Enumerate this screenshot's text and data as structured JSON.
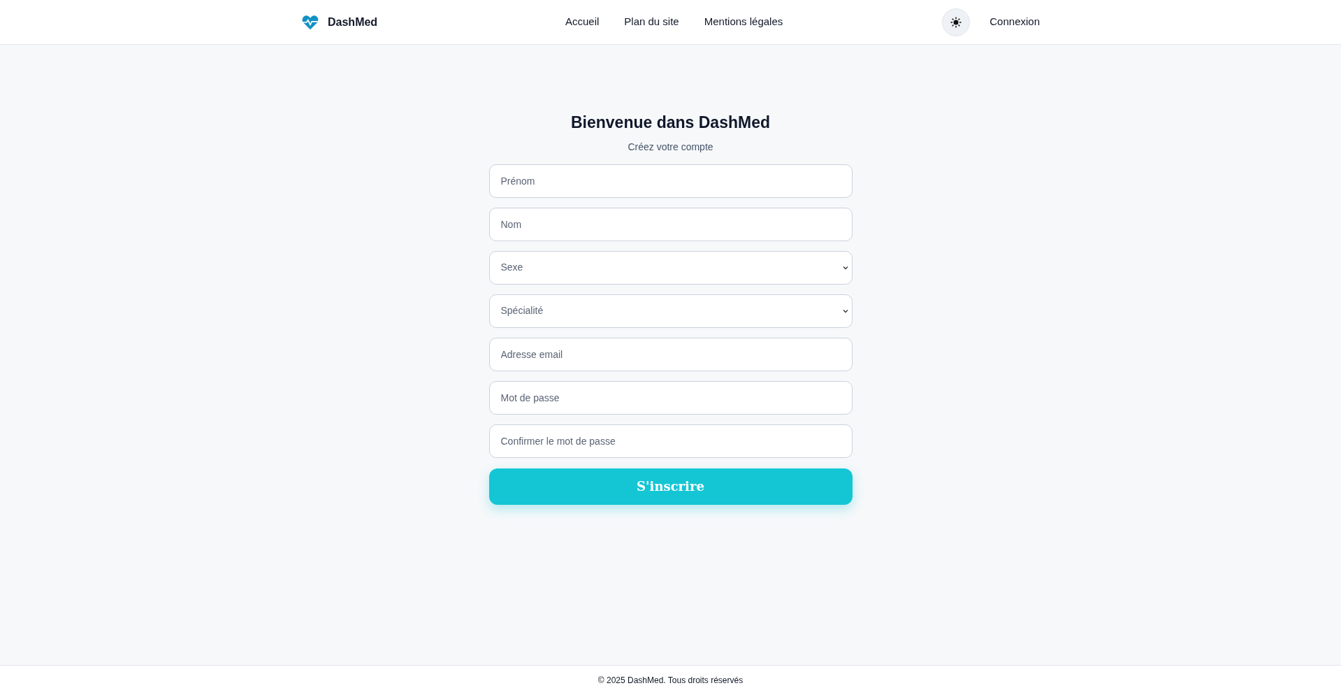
{
  "header": {
    "brand": "DashMed",
    "nav": [
      {
        "label": "Accueil"
      },
      {
        "label": "Plan du site"
      },
      {
        "label": "Mentions légales"
      }
    ],
    "login": "Connexion"
  },
  "form": {
    "title": "Bienvenue dans DashMed",
    "subtitle": "Créez votre compte",
    "fields": [
      {
        "kind": "text",
        "placeholder": "Prénom"
      },
      {
        "kind": "text",
        "placeholder": "Nom"
      },
      {
        "kind": "select",
        "placeholder": "Sexe"
      },
      {
        "kind": "select",
        "placeholder": "Spécialité"
      },
      {
        "kind": "text",
        "placeholder": "Adresse email"
      },
      {
        "kind": "text",
        "placeholder": "Mot de passe"
      },
      {
        "kind": "text",
        "placeholder": "Confirmer le mot de passe"
      }
    ],
    "submit": "S'inscrire"
  },
  "footer": "© 2025 DashMed. Tous droits réservés"
}
